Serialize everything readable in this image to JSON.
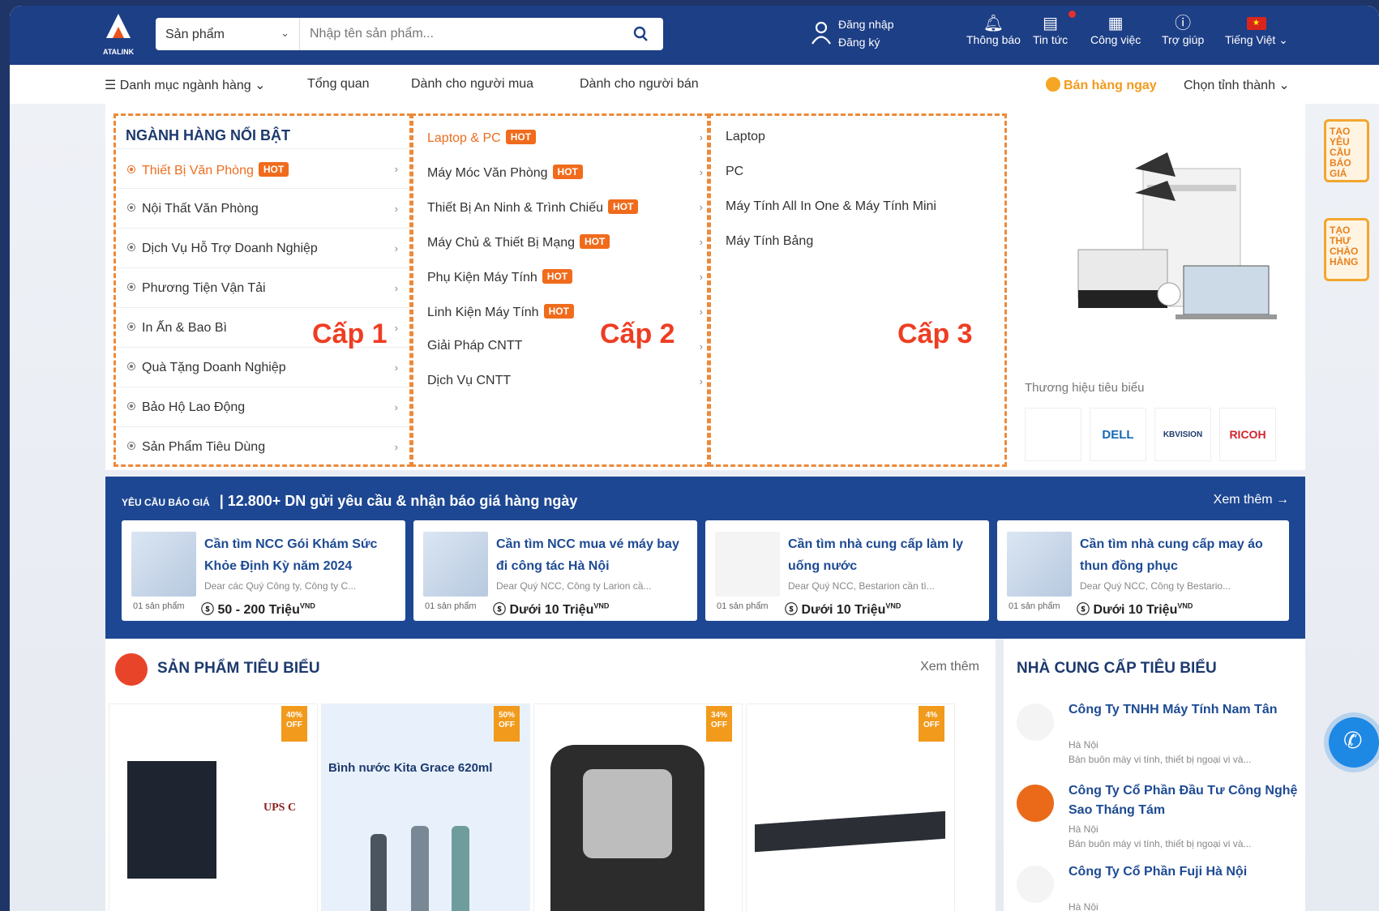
{
  "header": {
    "logo_text": "ATALINK",
    "search_category": "Sản phẩm",
    "search_placeholder": "Nhập tên sản phẩm...",
    "login": "Đăng nhập",
    "register": "Đăng ký",
    "nav": [
      {
        "label": "Thông báo",
        "icon": "bell-icon"
      },
      {
        "label": "Tin tức",
        "icon": "news-icon"
      },
      {
        "label": "Công việc",
        "icon": "calendar-icon"
      },
      {
        "label": "Trợ giúp",
        "icon": "help-icon"
      },
      {
        "label": "Tiếng Việt",
        "icon": "vietnam-flag-icon"
      }
    ]
  },
  "subnav": {
    "categories": "Danh mục ngành hàng",
    "items": [
      "Tổng quan",
      "Dành cho người mua",
      "Dành cho người bán"
    ],
    "sell_now": "Bán hàng ngay",
    "province": "Chọn tỉnh thành"
  },
  "menu": {
    "level1_title": "NGÀNH HÀNG NỔI BẬT",
    "hot_label": "HOT",
    "level1": [
      {
        "label": "Thiết Bị Văn Phòng",
        "hot": true,
        "active": true
      },
      {
        "label": "Nội Thất Văn Phòng"
      },
      {
        "label": "Dịch Vụ Hỗ Trợ Doanh Nghiệp"
      },
      {
        "label": "Phương Tiện Vận Tải"
      },
      {
        "label": "In Ấn & Bao Bì"
      },
      {
        "label": "Quà Tặng Doanh Nghiệp"
      },
      {
        "label": "Bảo Hộ Lao Động"
      },
      {
        "label": "Sản Phẩm Tiêu Dùng"
      }
    ],
    "level2": [
      {
        "label": "Laptop & PC",
        "hot": true,
        "active": true
      },
      {
        "label": "Máy Móc Văn Phòng",
        "hot": true
      },
      {
        "label": "Thiết Bị An Ninh & Trình Chiếu",
        "hot": true
      },
      {
        "label": "Máy Chủ & Thiết Bị Mạng",
        "hot": true
      },
      {
        "label": "Phụ Kiện Máy Tính",
        "hot": true
      },
      {
        "label": "Linh Kiện Máy Tính",
        "hot": true
      },
      {
        "label": "Giải Pháp CNTT"
      },
      {
        "label": "Dịch Vụ CNTT"
      }
    ],
    "level3": [
      "Laptop",
      "PC",
      "Máy Tính All In One & Máy Tính Mini",
      "Máy Tính Bảng"
    ],
    "annotations": [
      "Cấp 1",
      "Cấp 2",
      "Cấp 3"
    ],
    "brands_title": "Thương hiệu tiêu biểu",
    "brands": [
      "",
      "DELL",
      "KBVISION",
      "RICOH"
    ]
  },
  "rfq": {
    "label": "YÊU CẦU BÁO GIÁ",
    "title": "12.800+ DN gửi yêu cầu & nhận báo giá hàng ngày",
    "more": "Xem thêm →",
    "count_label": "01 sản phẩm",
    "currency": "VND",
    "cards": [
      {
        "title": "Cần tìm NCC Gói Khám Sức Khỏe Định Kỳ năm 2024",
        "desc": "Dear các Quý Công ty, Công ty C...",
        "price": "50 - 200 Triệu"
      },
      {
        "title": "Cần tìm NCC mua vé máy bay đi công tác Hà Nội",
        "desc": "Dear Quý NCC, Công ty Larion cầ...",
        "price": "Dưới 10 Triệu"
      },
      {
        "title": "Cần tìm nhà cung cấp làm ly uống nước",
        "desc": "Dear Quý NCC, Bestarion cần tì...",
        "price": "Dưới 10 Triệu"
      },
      {
        "title": "Cần tìm nhà cung cấp may áo thun đồng phục",
        "desc": "Dear Quý NCC, Công ty Bestario...",
        "price": "Dưới 10 Triệu"
      }
    ]
  },
  "products": {
    "title": "SẢN PHẨM TIÊU BIỂU",
    "more": "Xem thêm",
    "off_label": "OFF",
    "items": [
      {
        "discount": "40%",
        "caption": "UPS C"
      },
      {
        "discount": "50%",
        "caption": "Bình nước Kita Grace 620ml"
      },
      {
        "discount": "34%",
        "caption": ""
      },
      {
        "discount": "4%",
        "caption": ""
      }
    ]
  },
  "suppliers": {
    "title": "NHÀ CUNG CẤP TIÊU BIỂU",
    "items": [
      {
        "name": "Công Ty TNHH Máy Tính Nam Tân",
        "location": "Hà Nội",
        "desc": "Bán buôn máy vi tính, thiết bị ngoại vi và..."
      },
      {
        "name": "Công Ty Cổ Phần Đầu Tư Công Nghệ Sao Tháng Tám",
        "location": "Hà Nội",
        "desc": "Bán buôn máy vi tính, thiết bị ngoại vi và..."
      },
      {
        "name": "Công Ty Cổ Phần Fuji Hà Nội",
        "location": "Hà Nội",
        "desc": ""
      }
    ]
  },
  "side_buttons": [
    "TẠO YÊU CẦU BÁO GIÁ",
    "TẠO THƯ CHÀO HÀNG"
  ],
  "colors": {
    "primary": "#1d3f86",
    "accent": "#ee6d1f",
    "annotation": "#ee3d22"
  }
}
